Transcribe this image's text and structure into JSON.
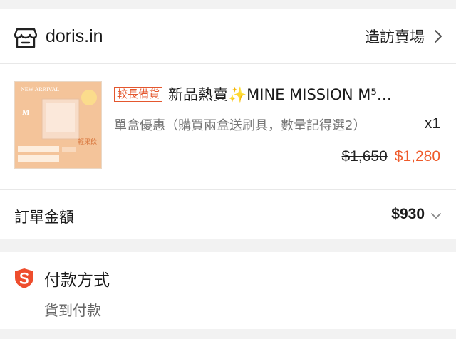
{
  "shop": {
    "name": "doris.in",
    "visit_label": "造訪賣場"
  },
  "product": {
    "tag": "較長備貨",
    "title": "新品熱賣✨MINE MISSION M⁵…",
    "variant": "單盒優惠（購買兩盒送刷具，數量記得選2）",
    "quantity": "x1",
    "price_original": "$1,650",
    "price_sale": "$1,280",
    "thumbnail": {
      "banner": "NEW ARRIVAL",
      "logo": "M",
      "sticker": "輕果飲"
    }
  },
  "order_total": {
    "label": "訂單金額",
    "value": "$930"
  },
  "payment": {
    "title": "付款方式",
    "method": "貨到付款"
  },
  "colors": {
    "accent": "#ee5a2a",
    "tag": "#e4572e",
    "background": "#f2f2f2"
  },
  "icons": {
    "shop": "store-icon",
    "visit": "chevron-right-icon",
    "total": "chevron-down-icon",
    "payment": "shield-s-icon"
  }
}
